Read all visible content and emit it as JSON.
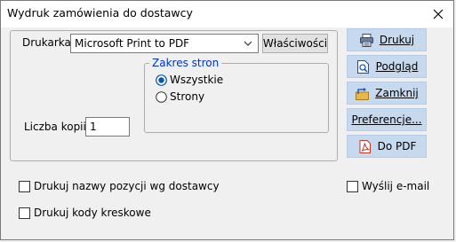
{
  "window": {
    "title": "Wydruk zamówienia do dostawcy"
  },
  "printer": {
    "label": "Drukarka:",
    "selected": "Microsoft Print to PDF",
    "properties_label": "Właściwości"
  },
  "page_range": {
    "legend": "Zakres stron",
    "options": [
      {
        "label": "Wszystkie",
        "selected": true
      },
      {
        "label": "Strony",
        "selected": false
      }
    ]
  },
  "copies": {
    "label": "Liczba kopii:",
    "value": "1"
  },
  "side_buttons": {
    "print": "Drukuj",
    "preview": "Podgląd",
    "close": "Zamknij",
    "preferences": "Preferencje...",
    "pdf": "Do PDF"
  },
  "options": {
    "supplier_names": {
      "label": "Drukuj nazwy pozycji wg dostawcy",
      "checked": false
    },
    "barcodes": {
      "label": "Drukuj kody kreskowe",
      "checked": false
    },
    "send_email": {
      "label": "Wyślij e-mail",
      "checked": false
    }
  },
  "colors": {
    "accent_button": "#c7d9ee",
    "legend_text": "#0033cc",
    "radio_selected": "#0056b3"
  }
}
